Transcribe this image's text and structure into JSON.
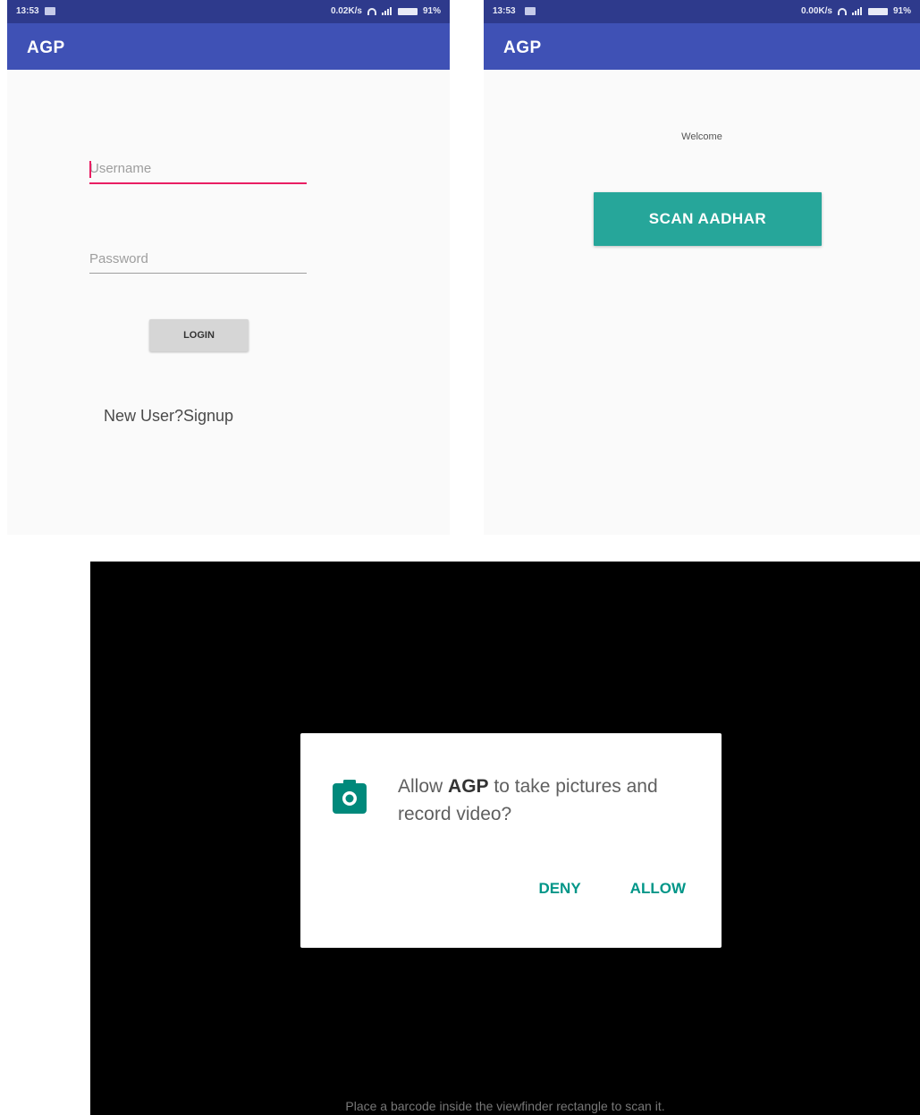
{
  "status_bar": {
    "time": "13:53",
    "login_network_speed": "0.02K/s",
    "home_network_speed": "0.00K/s",
    "battery": "91%"
  },
  "app": {
    "title": "AGP"
  },
  "login_screen": {
    "username_placeholder": "Username",
    "password_placeholder": "Password",
    "login_label": "LOGIN",
    "signup_label": "New User?Signup"
  },
  "home_screen": {
    "welcome_text": "Welcome",
    "scan_button_label": "SCAN AADHAR"
  },
  "permission_dialog": {
    "message_prefix": "Allow ",
    "app_name": "AGP",
    "message_suffix": " to take pictures and record video?",
    "deny_label": "DENY",
    "allow_label": "ALLOW"
  },
  "scanner": {
    "hint": "Place a barcode inside the viewfinder rectangle to scan it."
  },
  "colors": {
    "app_bar": "#3f51b5",
    "status_bar": "#2e3a8c",
    "accent_pink": "#e91e63",
    "scan_button": "#26a69a",
    "dialog_action": "#009688"
  },
  "icons": [
    "notification-icon",
    "wifi-icon",
    "signal-icon",
    "battery-icon",
    "camera-icon"
  ]
}
